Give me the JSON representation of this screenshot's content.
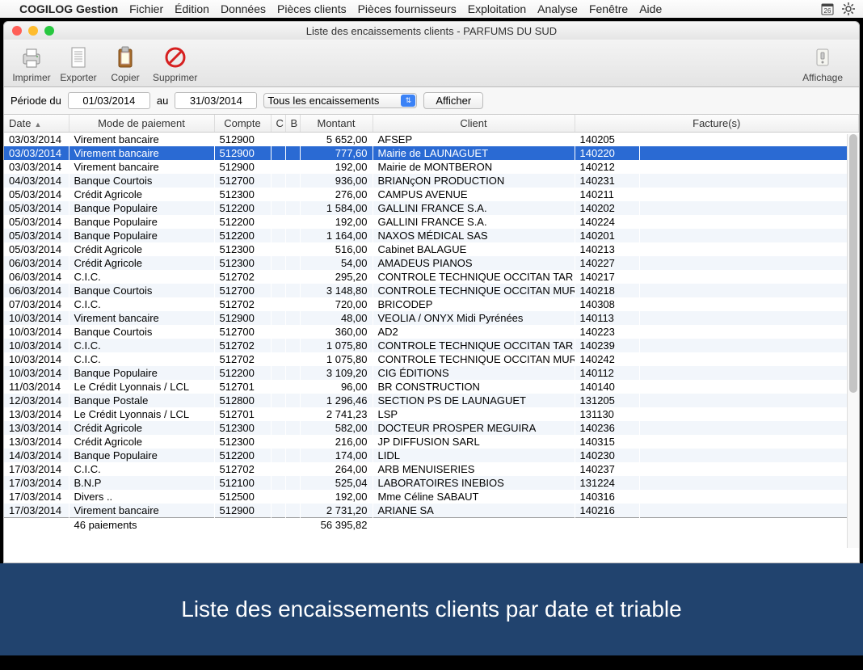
{
  "menubar": {
    "app": "COGILOG Gestion",
    "items": [
      "Fichier",
      "Édition",
      "Données",
      "Pièces clients",
      "Pièces fournisseurs",
      "Exploitation",
      "Analyse",
      "Fenêtre",
      "Aide"
    ],
    "right_icons": [
      "calendar-icon",
      "gear-icon"
    ]
  },
  "window": {
    "title": "Liste des encaissements clients - PARFUMS DU SUD"
  },
  "toolbar": {
    "print": "Imprimer",
    "export": "Exporter",
    "copy": "Copier",
    "delete": "Supprimer",
    "display": "Affichage"
  },
  "filter": {
    "period_from_label": "Période du",
    "from": "01/03/2014",
    "to_label": "au",
    "to": "31/03/2014",
    "scope_options": [
      "Tous les encaissements"
    ],
    "scope_value": "Tous les encaissements",
    "show_btn": "Afficher"
  },
  "columns": {
    "date": "Date",
    "mode": "Mode de paiement",
    "compte": "Compte",
    "c": "C",
    "b": "B",
    "montant": "Montant",
    "client": "Client",
    "factures": "Facture(s)"
  },
  "rows": [
    {
      "date": "03/03/2014",
      "mode": "Virement bancaire",
      "compte": "512900",
      "montant": "5 652,00",
      "client": "AFSEP",
      "fac": "140205"
    },
    {
      "date": "03/03/2014",
      "mode": "Virement bancaire",
      "compte": "512900",
      "montant": "777,60",
      "client": "Mairie de LAUNAGUET",
      "fac": "140220",
      "sel": true
    },
    {
      "date": "03/03/2014",
      "mode": "Virement bancaire",
      "compte": "512900",
      "montant": "192,00",
      "client": "Mairie de MONTBERON",
      "fac": "140212"
    },
    {
      "date": "04/03/2014",
      "mode": "Banque Courtois",
      "compte": "512700",
      "montant": "936,00",
      "client": "BRIANçON PRODUCTION",
      "fac": "140231"
    },
    {
      "date": "05/03/2014",
      "mode": "Crédit Agricole",
      "compte": "512300",
      "montant": "276,00",
      "client": "CAMPUS AVENUE",
      "fac": "140211"
    },
    {
      "date": "05/03/2014",
      "mode": "Banque Populaire",
      "compte": "512200",
      "montant": "1 584,00",
      "client": "GALLINI FRANCE S.A.",
      "fac": "140202"
    },
    {
      "date": "05/03/2014",
      "mode": "Banque Populaire",
      "compte": "512200",
      "montant": "192,00",
      "client": "GALLINI FRANCE S.A.",
      "fac": "140224"
    },
    {
      "date": "05/03/2014",
      "mode": "Banque Populaire",
      "compte": "512200",
      "montant": "1 164,00",
      "client": "NAXOS MÉDICAL SAS",
      "fac": "140201"
    },
    {
      "date": "05/03/2014",
      "mode": "Crédit Agricole",
      "compte": "512300",
      "montant": "516,00",
      "client": "Cabinet  BALAGUE",
      "fac": "140213"
    },
    {
      "date": "06/03/2014",
      "mode": "Crédit Agricole",
      "compte": "512300",
      "montant": "54,00",
      "client": "AMADEUS PIANOS",
      "fac": "140227"
    },
    {
      "date": "06/03/2014",
      "mode": "C.I.C.",
      "compte": "512702",
      "montant": "295,20",
      "client": "CONTROLE TECHNIQUE OCCITAN TAR",
      "fac": "140217"
    },
    {
      "date": "06/03/2014",
      "mode": "Banque Courtois",
      "compte": "512700",
      "montant": "3 148,80",
      "client": "CONTROLE TECHNIQUE OCCITAN MUR",
      "fac": "140218"
    },
    {
      "date": "07/03/2014",
      "mode": "C.I.C.",
      "compte": "512702",
      "montant": "720,00",
      "client": "BRICODEP",
      "fac": "140308"
    },
    {
      "date": "10/03/2014",
      "mode": "Virement bancaire",
      "compte": "512900",
      "montant": "48,00",
      "client": "VEOLIA / ONYX Midi Pyrénées",
      "fac": "140113"
    },
    {
      "date": "10/03/2014",
      "mode": "Banque Courtois",
      "compte": "512700",
      "montant": "360,00",
      "client": "AD2",
      "fac": "140223"
    },
    {
      "date": "10/03/2014",
      "mode": "C.I.C.",
      "compte": "512702",
      "montant": "1 075,80",
      "client": "CONTROLE TECHNIQUE OCCITAN TAR",
      "fac": "140239"
    },
    {
      "date": "10/03/2014",
      "mode": "C.I.C.",
      "compte": "512702",
      "montant": "1 075,80",
      "client": "CONTROLE TECHNIQUE OCCITAN MUR",
      "fac": "140242"
    },
    {
      "date": "10/03/2014",
      "mode": "Banque Populaire",
      "compte": "512200",
      "montant": "3 109,20",
      "client": "CIG ÉDITIONS",
      "fac": "140112"
    },
    {
      "date": "11/03/2014",
      "mode": "Le Crédit Lyonnais / LCL",
      "compte": "512701",
      "montant": "96,00",
      "client": "BR CONSTRUCTION",
      "fac": "140140"
    },
    {
      "date": "12/03/2014",
      "mode": "Banque Postale",
      "compte": "512800",
      "montant": "1 296,46",
      "client": "SECTION PS DE LAUNAGUET",
      "fac": "131205"
    },
    {
      "date": "13/03/2014",
      "mode": "Le Crédit Lyonnais / LCL",
      "compte": "512701",
      "montant": "2 741,23",
      "client": "LSP",
      "fac": "131130"
    },
    {
      "date": "13/03/2014",
      "mode": "Crédit Agricole",
      "compte": "512300",
      "montant": "582,00",
      "client": "DOCTEUR PROSPER MEGUIRA",
      "fac": "140236"
    },
    {
      "date": "13/03/2014",
      "mode": "Crédit Agricole",
      "compte": "512300",
      "montant": "216,00",
      "client": "JP DIFFUSION SARL",
      "fac": "140315"
    },
    {
      "date": "14/03/2014",
      "mode": "Banque Populaire",
      "compte": "512200",
      "montant": "174,00",
      "client": "LIDL",
      "fac": "140230"
    },
    {
      "date": "17/03/2014",
      "mode": "C.I.C.",
      "compte": "512702",
      "montant": "264,00",
      "client": "ARB MENUISERIES",
      "fac": "140237"
    },
    {
      "date": "17/03/2014",
      "mode": "B.N.P",
      "compte": "512100",
      "montant": "525,04",
      "client": "LABORATOIRES INEBIOS",
      "fac": "131224"
    },
    {
      "date": "17/03/2014",
      "mode": "Divers ..",
      "compte": "512500",
      "montant": "192,00",
      "client": "Mme Céline SABAUT",
      "fac": "140316"
    },
    {
      "date": "17/03/2014",
      "mode": "Virement bancaire",
      "compte": "512900",
      "montant": "2 731,20",
      "client": "ARIANE SA",
      "fac": "140216"
    }
  ],
  "totals": {
    "count_label": "46 paiements",
    "sum": "56 395,82"
  },
  "caption": "Liste des encaissements clients par date et triable"
}
